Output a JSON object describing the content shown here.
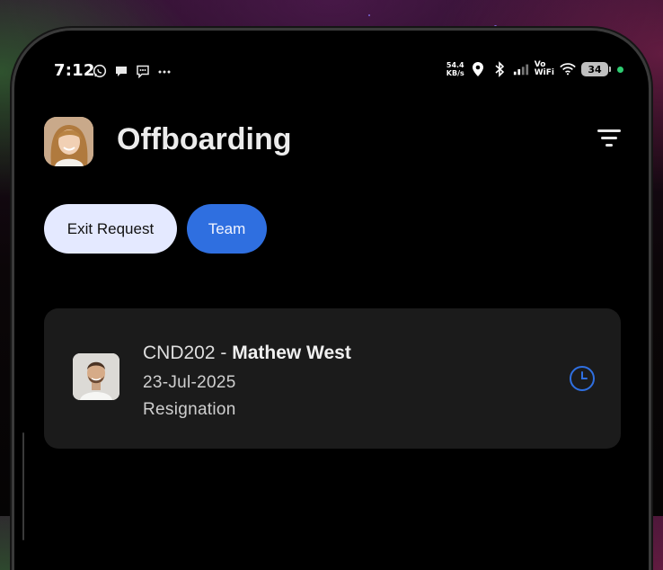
{
  "status_bar": {
    "time": "7:12",
    "left_icons": [
      "whatsapp-icon",
      "chat-bubble-icon",
      "message-icon",
      "more-dots-icon"
    ],
    "net_speed_value": "54.4",
    "net_speed_unit": "KB/s",
    "vowifi_top": "Vo",
    "vowifi_bottom": "WiFi",
    "battery": "34",
    "right_icons": [
      "location-icon",
      "bluetooth-icon",
      "signal-icon",
      "wifi-icon",
      "battery-icon"
    ]
  },
  "header": {
    "title": "Offboarding",
    "filter_icon": "filter-icon"
  },
  "tabs": [
    {
      "label": "Exit Request",
      "active": false
    },
    {
      "label": "Team",
      "active": true
    }
  ],
  "requests": [
    {
      "code": "CND202",
      "separator": " - ",
      "name": "Mathew West",
      "date": "23-Jul-2025",
      "type": "Resignation",
      "status_icon": "clock-icon"
    }
  ],
  "colors": {
    "accent": "#2f6fe0",
    "tab_inactive": "#e4e9ff",
    "card_bg": "#1b1b1b",
    "status_dot": "#2ecc71"
  }
}
